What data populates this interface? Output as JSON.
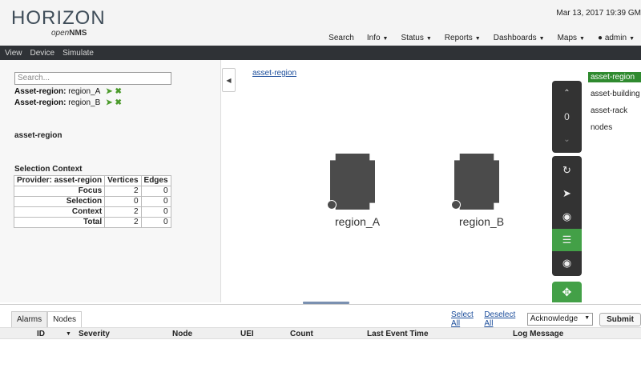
{
  "header": {
    "logo_main": "HORIZON",
    "logo_sub_open": "open",
    "logo_sub_nms": "NMS",
    "datetime": "Mar 13, 2017 19:39 GM",
    "nav": [
      {
        "label": "Search",
        "dropdown": false
      },
      {
        "label": "Info",
        "dropdown": true
      },
      {
        "label": "Status",
        "dropdown": true
      },
      {
        "label": "Reports",
        "dropdown": true
      },
      {
        "label": "Dashboards",
        "dropdown": true
      },
      {
        "label": "Maps",
        "dropdown": true
      },
      {
        "label": "admin",
        "dropdown": true,
        "icon": "user-icon"
      }
    ]
  },
  "subbar": {
    "view": "View",
    "device": "Device",
    "simulate": "Simulate"
  },
  "left": {
    "search_placeholder": "Search...",
    "selections": [
      {
        "prefix": "Asset-region:",
        "value": "region_A"
      },
      {
        "prefix": "Asset-region:",
        "value": "region_B"
      }
    ],
    "layer_title": "asset-region",
    "selection_context_title": "Selection Context",
    "table": {
      "headers": [
        "Provider: asset-region",
        "Vertices",
        "Edges"
      ],
      "rows": [
        {
          "label": "Focus",
          "vertices": "2",
          "edges": "0"
        },
        {
          "label": "Selection",
          "vertices": "0",
          "edges": "0"
        },
        {
          "label": "Context",
          "vertices": "2",
          "edges": "0"
        },
        {
          "label": "Total",
          "vertices": "2",
          "edges": "0"
        }
      ]
    }
  },
  "canvas": {
    "breadcrumb": "asset-region",
    "vertices": [
      "region_A",
      "region_B"
    ],
    "zoom_level": "0"
  },
  "layers": {
    "items": [
      "asset-region",
      "asset-building",
      "asset-rack",
      "nodes"
    ],
    "active": "asset-region"
  },
  "bottom": {
    "tabs": [
      "Alarms",
      "Nodes"
    ],
    "active_tab": "Nodes",
    "select_all": "Select All",
    "deselect_all": "Deselect All",
    "action_value": "Acknowledge",
    "submit": "Submit",
    "columns": [
      "ID",
      "Severity",
      "Node",
      "UEI",
      "Count",
      "Last Event Time",
      "Log Message"
    ]
  }
}
